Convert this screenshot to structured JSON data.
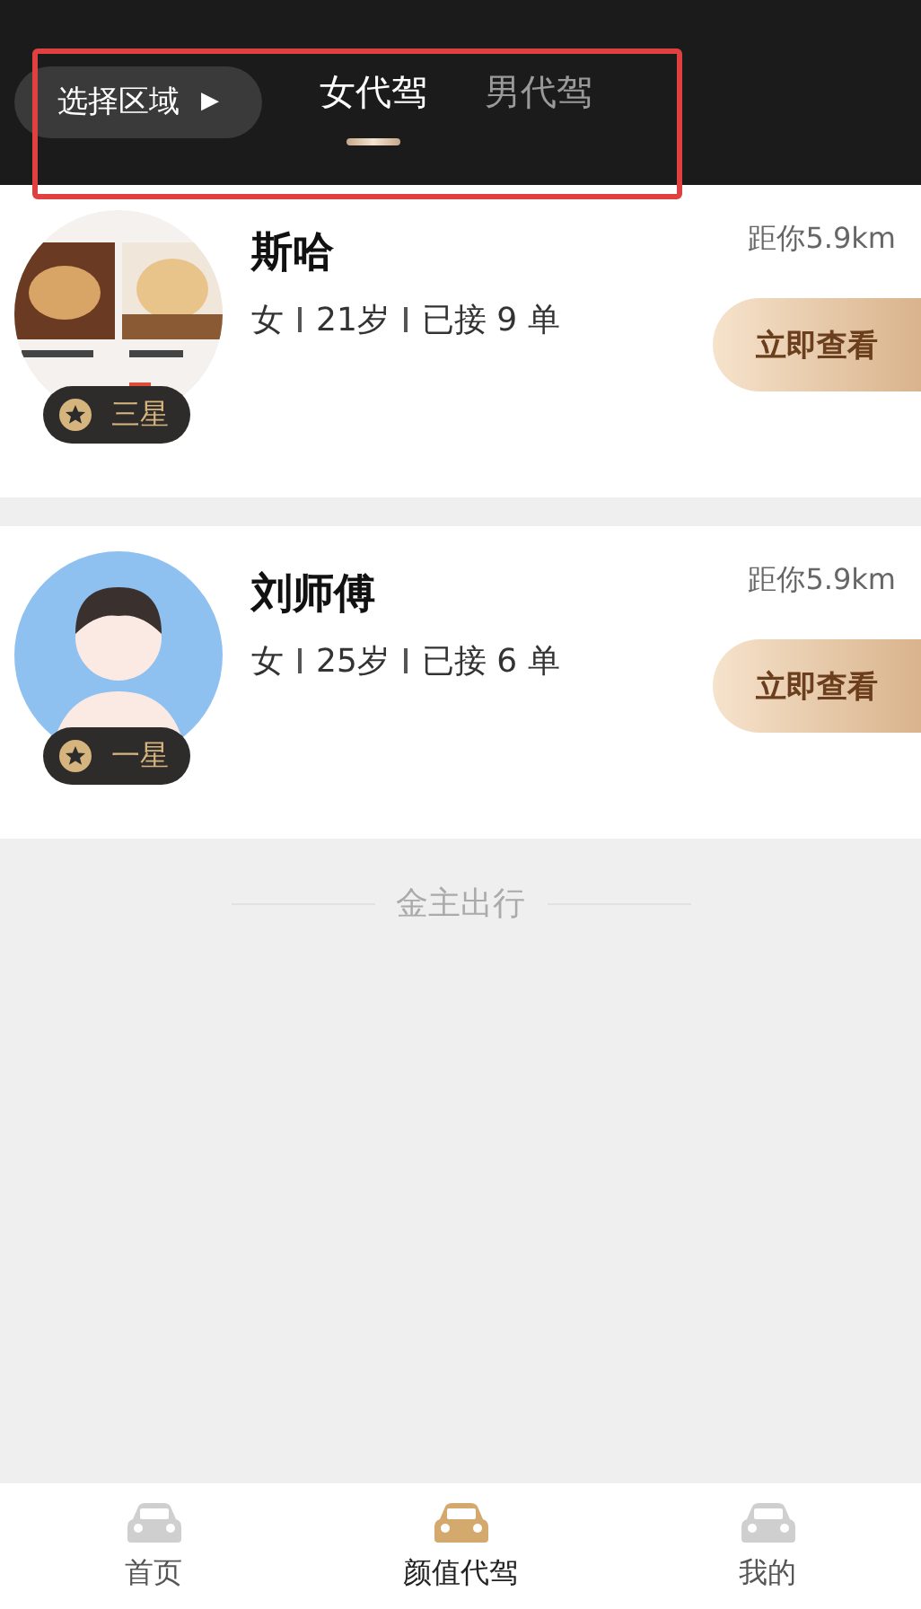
{
  "header": {
    "region_button": "选择区域",
    "region_arrow": "▶",
    "tabs": [
      {
        "label": "女代驾",
        "selected": true
      },
      {
        "label": "男代驾",
        "selected": false
      }
    ]
  },
  "drivers": [
    {
      "name": "斯哈",
      "details": [
        "女",
        "21岁",
        "已接 9 单"
      ],
      "distance": "距你5.9km",
      "rank": "三星",
      "action": "立即查看",
      "kind": "picture"
    },
    {
      "name": "刘师傅",
      "details": [
        "女",
        "25岁",
        "已接 6 单"
      ],
      "distance": "距你5.9km",
      "rank": "一星",
      "action": "立即查看",
      "kind": "avatar"
    }
  ],
  "footer_note": "金主出行",
  "bottom_nav": [
    {
      "label": "首页",
      "selected": false
    },
    {
      "label": "颜值代驾",
      "selected": true
    },
    {
      "label": "我的",
      "selected": false
    }
  ]
}
